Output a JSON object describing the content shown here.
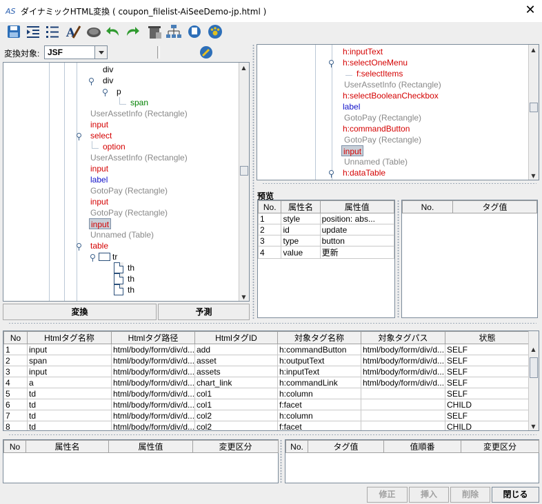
{
  "window": {
    "title": "ダイナミックHTML変換 ( coupon_filelist-AiSeeDemo-jp.html )",
    "close": "✕"
  },
  "toolbar": {
    "icons": [
      "save-icon",
      "indent-icon",
      "list-icon",
      "style-icon",
      "turtle-icon",
      "undo-icon",
      "redo-icon",
      "trash-icon",
      "network-icon",
      "disk-icon",
      "paw-icon"
    ]
  },
  "conv": {
    "label": "変換対象:",
    "value": "JSF",
    "run": "変換",
    "predict": "予測"
  },
  "left_tree": [
    {
      "text": "div",
      "cls": "blk"
    },
    {
      "text": "div",
      "cls": "blk"
    },
    {
      "text": "p",
      "cls": "blk"
    },
    {
      "text": "span",
      "cls": "green"
    },
    {
      "text": "UserAssetInfo (Rectangle)",
      "cls": "gray"
    },
    {
      "text": "input",
      "cls": "red"
    },
    {
      "text": "select",
      "cls": "red"
    },
    {
      "text": "option",
      "cls": "red"
    },
    {
      "text": "UserAssetInfo (Rectangle)",
      "cls": "gray"
    },
    {
      "text": "input",
      "cls": "red"
    },
    {
      "text": "label",
      "cls": "blue"
    },
    {
      "text": "GotoPay (Rectangle)",
      "cls": "gray"
    },
    {
      "text": "input",
      "cls": "red"
    },
    {
      "text": "GotoPay (Rectangle)",
      "cls": "gray"
    },
    {
      "text": "input",
      "cls": "red"
    },
    {
      "text": "Unnamed (Table)",
      "cls": "gray"
    },
    {
      "text": "table",
      "cls": "red"
    },
    {
      "text": "tr",
      "cls": "blk"
    },
    {
      "text": "th",
      "cls": "blk"
    },
    {
      "text": "th",
      "cls": "blk"
    },
    {
      "text": "th",
      "cls": "blk"
    }
  ],
  "right_tree": [
    {
      "text": "h:inputText",
      "cls": "red"
    },
    {
      "text": "h:selectOneMenu",
      "cls": "red"
    },
    {
      "text": "f:selectItems",
      "cls": "red"
    },
    {
      "text": "UserAssetInfo (Rectangle)",
      "cls": "gray"
    },
    {
      "text": "h:selectBooleanCheckbox",
      "cls": "red"
    },
    {
      "text": "label",
      "cls": "blue"
    },
    {
      "text": "GotoPay (Rectangle)",
      "cls": "gray"
    },
    {
      "text": "h:commandButton",
      "cls": "red"
    },
    {
      "text": "GotoPay (Rectangle)",
      "cls": "gray"
    },
    {
      "text": "input",
      "cls": "red"
    },
    {
      "text": "Unnamed (Table)",
      "cls": "gray"
    },
    {
      "text": "h:dataTable",
      "cls": "red"
    }
  ],
  "preview": {
    "label": "预览",
    "attr_headers": [
      "No.",
      "属性名",
      "属性值"
    ],
    "attr_rows": [
      [
        "1",
        "style",
        "position: abs..."
      ],
      [
        "2",
        "id",
        "update"
      ],
      [
        "3",
        "type",
        "button"
      ],
      [
        "4",
        "value",
        "更新"
      ]
    ],
    "tag_headers": [
      "No.",
      "タグ值"
    ]
  },
  "main_table": {
    "headers": [
      "No",
      "Htmlタグ名称",
      "Htmlタグ路径",
      "HtmlタグID",
      "対象タグ名称",
      "対象タグパス",
      "状態"
    ],
    "rows": [
      [
        "1",
        "input",
        "html/body/form/div/d...",
        "add",
        "h:commandButton",
        "html/body/form/div/d...",
        "SELF"
      ],
      [
        "2",
        "span",
        "html/body/form/div/d...",
        "asset",
        "h:outputText",
        "html/body/form/div/d...",
        "SELF"
      ],
      [
        "3",
        "input",
        "html/body/form/div/d...",
        "assets",
        "h:inputText",
        "html/body/form/div/d...",
        "SELF"
      ],
      [
        "4",
        "a",
        "html/body/form/div/d...",
        "chart_link",
        "h:commandLink",
        "html/body/form/div/d...",
        "SELF"
      ],
      [
        "5",
        "td",
        "html/body/form/div/d...",
        "col1",
        "h:column",
        "",
        "SELF"
      ],
      [
        "6",
        "td",
        "html/body/form/div/d...",
        "col1",
        "f:facet",
        "",
        "CHILD"
      ],
      [
        "7",
        "td",
        "html/body/form/div/d...",
        "col2",
        "h:column",
        "",
        "SELF"
      ],
      [
        "8",
        "td",
        "html/body/form/div/d...",
        "col2",
        "f:facet",
        "",
        "CHILD"
      ]
    ]
  },
  "bottom_left": {
    "headers": [
      "No",
      "属性名",
      "属性值",
      "変更区分"
    ]
  },
  "bottom_right": {
    "headers": [
      "No.",
      "タグ值",
      "值順番",
      "変更区分"
    ]
  },
  "buttons": {
    "modify": "修正",
    "insert": "挿入",
    "delete": "削除",
    "close": "閉じる"
  }
}
